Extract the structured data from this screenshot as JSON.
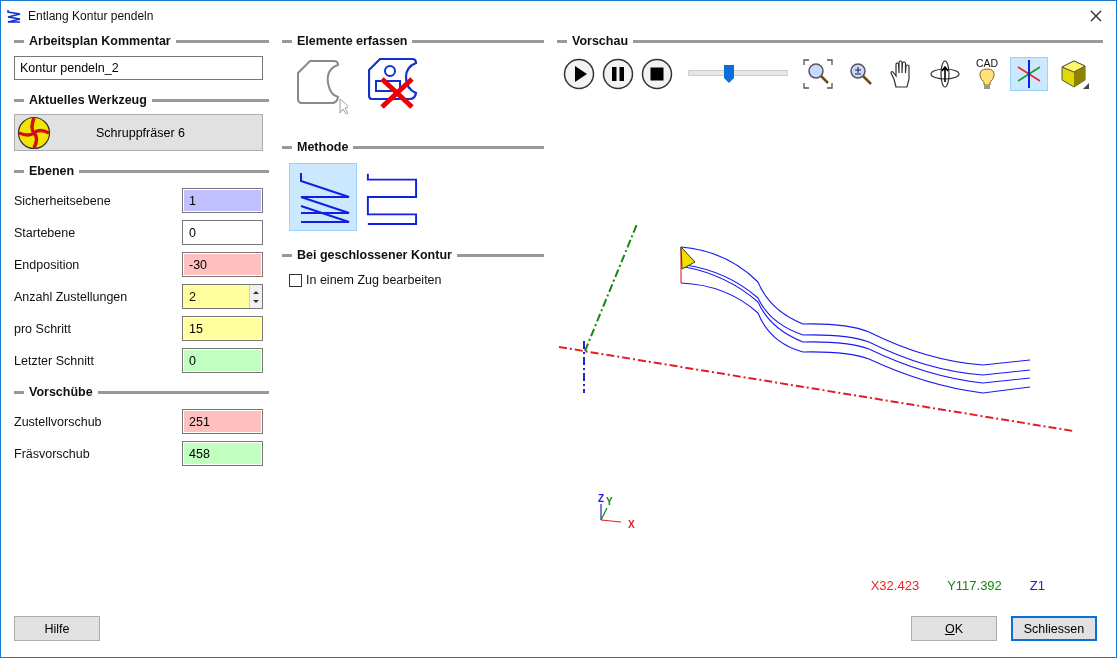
{
  "window": {
    "title": "Entlang Kontur pendeln"
  },
  "comment_section": {
    "title": "Arbeitsplan Kommentar",
    "value": "Kontur pendeln_2"
  },
  "tool_section": {
    "title": "Aktuelles Werkzeug",
    "tool": "Schruppfräser 6"
  },
  "planes_section": {
    "title": "Ebenen",
    "fields": [
      {
        "label": "Sicherheitsebene",
        "value": "1",
        "color": "#c0c0ff",
        "kind": "text"
      },
      {
        "label": "Startebene",
        "value": "0",
        "color": "#ffffff",
        "kind": "text"
      },
      {
        "label": "Endposition",
        "value": "-30",
        "color": "#ffc0c0",
        "kind": "text"
      },
      {
        "label": "Anzahl Zustellungen",
        "value": "2",
        "color": "#ffff9f",
        "kind": "spinner"
      },
      {
        "label": "pro Schritt",
        "value": "15",
        "color": "#ffff9f",
        "kind": "text"
      },
      {
        "label": "Letzter Schnitt",
        "value": "0",
        "color": "#c0ffc0",
        "kind": "text"
      }
    ]
  },
  "feeds_section": {
    "title": "Vorschübe",
    "fields": [
      {
        "label": "Zustellvorschub",
        "value": "251",
        "color": "#ffc0c0",
        "kind": "text"
      },
      {
        "label": "Fräsvorschub",
        "value": "458",
        "color": "#c0ffc0",
        "kind": "text"
      }
    ]
  },
  "elements_section": {
    "title": "Elemente erfassen",
    "tools": [
      {
        "kind": "select-contour"
      },
      {
        "kind": "remove-elements"
      }
    ]
  },
  "method_section": {
    "title": "Methode",
    "methods": [
      {
        "kind": "zigzag",
        "selected": true
      },
      {
        "kind": "meander",
        "selected": false
      }
    ]
  },
  "closed_contour_section": {
    "title": "Bei geschlossener Kontur",
    "option": {
      "label": "In einem Zug bearbeiten",
      "checked": false
    }
  },
  "preview": {
    "title": "Vorschau",
    "speed": {
      "level": 0.41
    },
    "tools": [
      {
        "kind": "zoom-fit",
        "selected": false
      },
      {
        "kind": "zoom",
        "selected": false
      },
      {
        "kind": "pan",
        "selected": false
      },
      {
        "kind": "rotate",
        "selected": false
      },
      {
        "kind": "cad-light",
        "selected": false,
        "label": "CAD"
      },
      {
        "kind": "axes",
        "selected": true
      },
      {
        "kind": "cube",
        "selected": false
      }
    ],
    "axis_labels": [
      "Z",
      "Y",
      "X"
    ],
    "coordinates": [
      {
        "text": "X32.423",
        "color": "#ee2222"
      },
      {
        "text": "Y117.392",
        "color": "#118811"
      },
      {
        "text": "Z1",
        "color": "#2222dd"
      }
    ]
  },
  "buttons": {
    "help": {
      "label": "Hilfe"
    },
    "ok": {
      "label": "OK",
      "mnemonic": true,
      "focused": false
    },
    "close": {
      "label": "Schliessen",
      "mnemonic": false,
      "focused": true
    }
  }
}
